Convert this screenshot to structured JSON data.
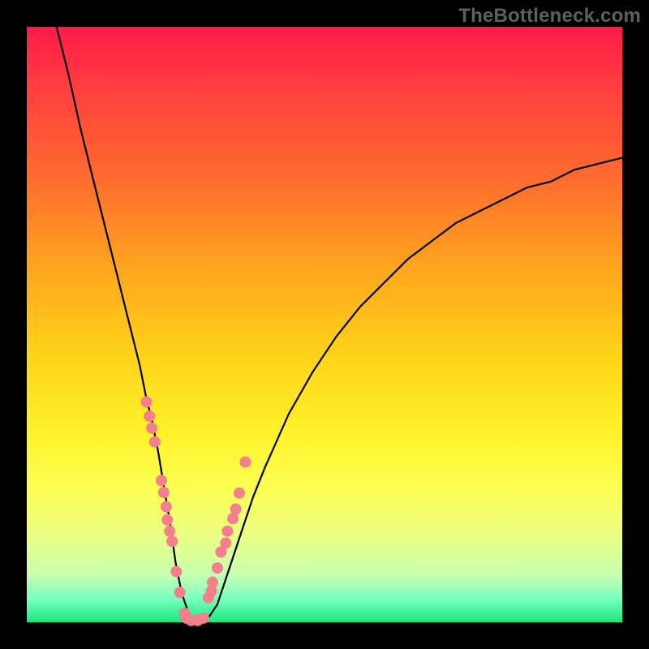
{
  "watermark": "TheBottleneck.com",
  "colors": {
    "curve_stroke": "#000000",
    "dot_fill": "#f57f8b",
    "dot_stroke": "#c95a68",
    "background": "#000000"
  },
  "chart_data": {
    "type": "line",
    "title": "",
    "xlabel": "",
    "ylabel": "",
    "xlim": [
      0,
      100
    ],
    "ylim": [
      0,
      100
    ],
    "grid": false,
    "curve": {
      "x": [
        5,
        7,
        9,
        11,
        13,
        15,
        17,
        19,
        20,
        21,
        22,
        23,
        24,
        25,
        26,
        27,
        28,
        30,
        32,
        34,
        36,
        38,
        40,
        44,
        48,
        52,
        56,
        60,
        64,
        68,
        72,
        76,
        80,
        84,
        88,
        92,
        96,
        100
      ],
      "y": [
        100,
        92,
        83,
        75,
        67,
        59,
        51,
        43,
        38,
        34,
        29,
        23,
        17,
        10,
        5,
        2,
        0,
        0,
        3,
        9,
        15,
        21,
        26,
        35,
        42,
        48,
        53,
        57,
        61,
        64,
        67,
        69,
        71,
        73,
        74,
        76,
        77,
        78
      ]
    },
    "highlight_dots_left": {
      "x": [
        20.1,
        20.6,
        21.0,
        21.5,
        22.6,
        23.0,
        23.4,
        23.6,
        24.0,
        24.4,
        25.1,
        25.7,
        26.5
      ],
      "y": [
        37.0,
        34.6,
        32.6,
        30.3,
        23.8,
        21.8,
        19.4,
        17.2,
        15.3,
        13.6,
        8.5,
        5.0,
        1.5
      ]
    },
    "highlight_dots_right": {
      "x": [
        30.5,
        31.0,
        31.2,
        32.0,
        32.6,
        33.4,
        33.7,
        34.6,
        35.1,
        35.7,
        36.7
      ],
      "y": [
        4.1,
        5.2,
        6.7,
        9.1,
        11.8,
        13.3,
        15.3,
        17.4,
        19.0,
        21.7,
        26.9
      ]
    },
    "highlight_dots_bottom": {
      "x": [
        26.8,
        27.6,
        28.7,
        29.7
      ],
      "y": [
        0.7,
        0.3,
        0.3,
        0.7
      ]
    }
  }
}
